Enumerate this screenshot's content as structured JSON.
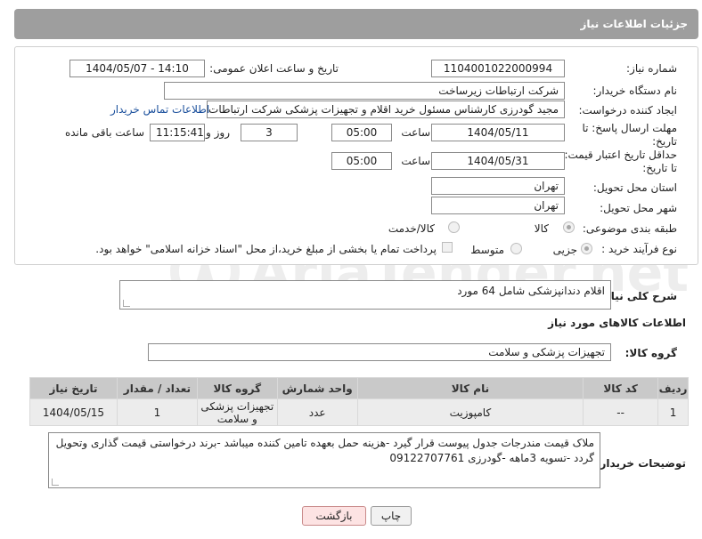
{
  "header": {
    "title": "جزئیات اطلاعات نیاز"
  },
  "form": {
    "need_number_label": "شماره نیاز:",
    "need_number": "1104001022000994",
    "announce_label": "تاریخ و ساعت اعلان عمومی:",
    "announce_value": "1404/05/07 - 14:10",
    "buyer_org_label": "نام دستگاه خریدار:",
    "buyer_org": "شرکت ارتباطات زیرساخت",
    "requester_label": "ایجاد کننده درخواست:",
    "requester": "مجید گودرزی کارشناس مسئول خرید اقلام و تجهیزات پزشکی شرکت ارتباطات ز",
    "buyer_contact_link": "اطلاعات تماس خریدار",
    "deadline_label_1": "مهلت ارسال پاسخ: تا",
    "deadline_label_2": "تاریخ:",
    "deadline_date": "1404/05/11",
    "time_label": "ساعت",
    "deadline_time": "05:00",
    "days_value": "3",
    "days_label": "روز و",
    "remaining_time": "11:15:41",
    "remaining_label": "ساعت باقی مانده",
    "validity_label_1": "حداقل تاریخ اعتبار قیمت:",
    "validity_label_2": "تا تاریخ:",
    "validity_date": "1404/05/31",
    "validity_time": "05:00",
    "province_label": "استان محل تحویل:",
    "province": "تهران",
    "city_label": "شهر محل تحویل:",
    "city": "تهران",
    "category_label": "طبقه بندی موضوعی:",
    "category_options": [
      "کالا",
      "کالا/خدمت"
    ],
    "category_selected": "کالا",
    "process_label": "نوع فرآیند خرید :",
    "process_options": [
      "جزیی",
      "متوسط"
    ],
    "process_selected": "جزیی",
    "payment_note": "پرداخت تمام یا بخشی از مبلغ خرید،از محل \"اسناد خزانه اسلامی\" خواهد بود."
  },
  "summary": {
    "label": "شرح کلی نیاز:",
    "value": "اقلام دندانپزشکی شامل 64 مورد"
  },
  "goods_section": {
    "title": "اطلاعات کالاهای مورد نیاز",
    "group_label": "گروه کالا:",
    "group_value": "تجهیزات پزشکی و سلامت"
  },
  "table": {
    "headers": [
      "ردیف",
      "کد کالا",
      "نام کالا",
      "واحد شمارش",
      "گروه کالا",
      "تعداد / مقدار",
      "تاریخ نیاز"
    ],
    "rows": [
      {
        "row": "1",
        "code": "--",
        "name": "کامپوزیت",
        "unit": "عدد",
        "group": "تجهیزات پزشکی و سلامت",
        "qty": "1",
        "date": "1404/05/15"
      }
    ]
  },
  "buyer_notes": {
    "label": "توضیحات خریدار:",
    "value": "ملاک قیمت مندرجات جدول پیوست قرار گیرد -هزینه حمل بعهده تامین کننده میباشد -برند درخواستی قیمت گذاری وتحویل گردد -تسویه 3ماهه -گودرزی 09122707761"
  },
  "buttons": {
    "print": "چاپ",
    "back": "بازگشت"
  },
  "watermark": {
    "text": "AriaTender.net"
  },
  "colors": {
    "header_bg": "#9e9e9e",
    "link": "#1a4f9c",
    "back_button_bg": "#fde3e3",
    "table_header_bg": "#c9c9c9"
  }
}
